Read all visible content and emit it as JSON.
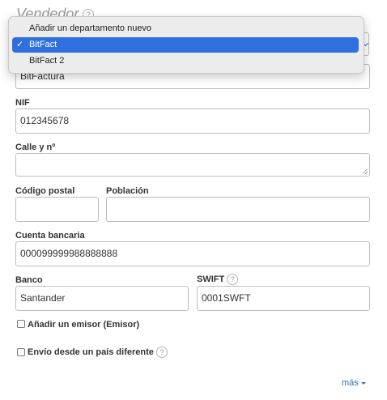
{
  "section": {
    "title": "Vendedor",
    "help": "?"
  },
  "dropdown": {
    "options": [
      "Añadir un departamento nuevo",
      "BitFact",
      "BitFact 2"
    ],
    "selected_index": 1,
    "check": "✓"
  },
  "company_name": {
    "value": "BitFactura"
  },
  "nif": {
    "label": "NIF",
    "value": "012345678"
  },
  "street": {
    "label": "Calle y nº",
    "value": ""
  },
  "postal_code": {
    "label": "Código postal",
    "value": ""
  },
  "city": {
    "label": "Población",
    "value": ""
  },
  "bank_account": {
    "label": "Cuenta bancaria",
    "value": "000099999988888888"
  },
  "bank": {
    "label": "Banco",
    "value": "Santander"
  },
  "swift": {
    "label": "SWIFT",
    "value": "0001SWFT",
    "help": "?"
  },
  "add_issuer": {
    "label": "Añadir un emisor (Emisor)",
    "checked": false
  },
  "ship_other_country": {
    "label": "Envío desde un país diferente",
    "checked": false,
    "help": "?"
  },
  "more": {
    "label": "más"
  },
  "colors": {
    "accent": "#2f6fe0",
    "link": "#2a6fb5",
    "border": "#bdbdbd"
  }
}
